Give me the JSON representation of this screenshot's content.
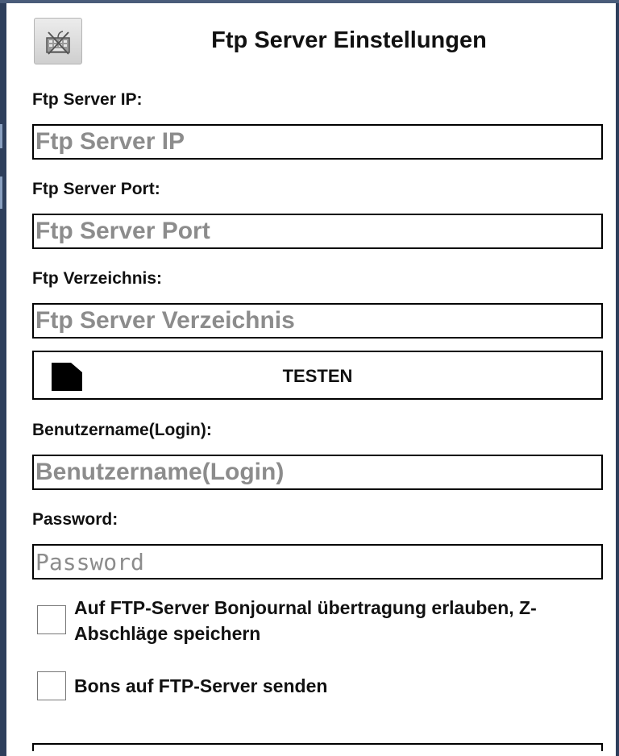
{
  "header": {
    "title": "Ftp Server Einstellungen",
    "keyboard_icon": "keyboard-off-icon"
  },
  "form": {
    "ip": {
      "label": "Ftp Server IP:",
      "placeholder": "Ftp Server IP",
      "value": ""
    },
    "port": {
      "label": "Ftp Server Port:",
      "placeholder": "Ftp Server Port",
      "value": ""
    },
    "directory": {
      "label": "Ftp Verzeichnis:",
      "placeholder": "Ftp Server Verzeichnis",
      "value": ""
    },
    "test_button": {
      "label": "TESTEN",
      "icon": "document-icon"
    },
    "username": {
      "label": "Benutzername(Login):",
      "placeholder": "Benutzername(Login)",
      "value": ""
    },
    "password": {
      "label": "Password:",
      "placeholder": "Password",
      "value": ""
    }
  },
  "options": [
    {
      "label": "Auf FTP-Server Bonjournal übertragung erlauben, Z-Abschläge speichern",
      "checked": false
    },
    {
      "label": "Bons auf FTP-Server senden",
      "checked": false
    }
  ],
  "colors": {
    "frame": "#2e3f5c",
    "placeholder": "#8c8c8c",
    "border": "#000000"
  }
}
